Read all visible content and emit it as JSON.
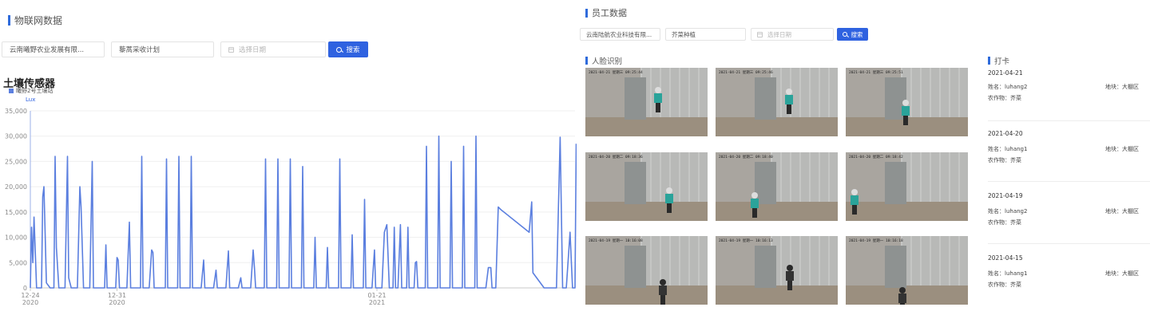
{
  "iot": {
    "title": "物联网数据",
    "company": "云南曦野农业发展有限...",
    "plan": "藜蒿采收计划",
    "date_placeholder": "选择日期",
    "search_label": "搜索"
  },
  "chart_data": {
    "type": "line",
    "title": "土壤传感器",
    "series": [
      {
        "name": "曦野2号土壤站",
        "color": "#5b7fdf"
      }
    ],
    "unit": "Lux",
    "ylim": [
      0,
      35000
    ],
    "yticks": [
      0,
      5000,
      10000,
      15000,
      20000,
      25000,
      30000,
      35000
    ],
    "ytick_labels": [
      "0",
      "5,000",
      "10,000",
      "15,000",
      "20,000",
      "25,000",
      "30,000",
      "35,000"
    ],
    "xticks": [
      {
        "label": "12-24",
        "sub": "2020",
        "x": 0
      },
      {
        "label": "12-31",
        "sub": "2020",
        "x": 7
      },
      {
        "label": "01-21",
        "sub": "2021",
        "x": 28
      }
    ],
    "xlim": [
      0,
      44
    ],
    "points": [
      [
        0,
        0
      ],
      [
        0.1,
        12000
      ],
      [
        0.2,
        5000
      ],
      [
        0.3,
        14000
      ],
      [
        0.5,
        0
      ],
      [
        0.9,
        0
      ],
      [
        1,
        18000
      ],
      [
        1.1,
        20000
      ],
      [
        1.3,
        1000
      ],
      [
        1.6,
        0
      ],
      [
        1.9,
        0
      ],
      [
        2,
        26000
      ],
      [
        2.1,
        8000
      ],
      [
        2.3,
        0
      ],
      [
        2.8,
        0
      ],
      [
        3,
        26000
      ],
      [
        3.1,
        2000
      ],
      [
        3.3,
        0
      ],
      [
        3.8,
        0
      ],
      [
        4,
        20000
      ],
      [
        4.1,
        16000
      ],
      [
        4.3,
        0
      ],
      [
        4.8,
        0
      ],
      [
        5,
        25000
      ],
      [
        5.1,
        0
      ],
      [
        6,
        0
      ],
      [
        6.1,
        8500
      ],
      [
        6.2,
        0
      ],
      [
        6.9,
        0
      ],
      [
        7,
        6000
      ],
      [
        7.1,
        5500
      ],
      [
        7.2,
        0
      ],
      [
        7.8,
        0
      ],
      [
        8,
        13000
      ],
      [
        8.1,
        0
      ],
      [
        8.9,
        0
      ],
      [
        9,
        26000
      ],
      [
        9.1,
        0
      ],
      [
        9.6,
        0
      ],
      [
        9.8,
        7500
      ],
      [
        9.9,
        7000
      ],
      [
        10,
        0
      ],
      [
        10.9,
        0
      ],
      [
        11,
        25500
      ],
      [
        11.1,
        0
      ],
      [
        11.9,
        0
      ],
      [
        12,
        26000
      ],
      [
        12.1,
        0
      ],
      [
        12.9,
        0
      ],
      [
        13,
        26000
      ],
      [
        13.1,
        0
      ],
      [
        13.8,
        0
      ],
      [
        14,
        5500
      ],
      [
        14.1,
        0
      ],
      [
        14.8,
        0
      ],
      [
        15,
        3500
      ],
      [
        15.1,
        0
      ],
      [
        15.8,
        0
      ],
      [
        16,
        7300
      ],
      [
        16.1,
        0
      ],
      [
        16.8,
        0
      ],
      [
        17,
        2000
      ],
      [
        17.1,
        0
      ],
      [
        17.8,
        0
      ],
      [
        18,
        7500
      ],
      [
        18.1,
        4000
      ],
      [
        18.2,
        0
      ],
      [
        18.9,
        0
      ],
      [
        19,
        25500
      ],
      [
        19.1,
        0
      ],
      [
        19.9,
        0
      ],
      [
        20,
        25500
      ],
      [
        20.1,
        0
      ],
      [
        20.9,
        0
      ],
      [
        21,
        25500
      ],
      [
        21.1,
        0
      ],
      [
        21.9,
        0
      ],
      [
        22,
        24000
      ],
      [
        22.1,
        0
      ],
      [
        22.9,
        0
      ],
      [
        23,
        10000
      ],
      [
        23.1,
        0
      ],
      [
        23.9,
        0
      ],
      [
        24,
        8000
      ],
      [
        24.1,
        0
      ],
      [
        24.9,
        0
      ],
      [
        25,
        25500
      ],
      [
        25.1,
        0
      ],
      [
        25.9,
        0
      ],
      [
        26,
        10500
      ],
      [
        26.1,
        0
      ],
      [
        26.9,
        0
      ],
      [
        27,
        17500
      ],
      [
        27.1,
        0
      ],
      [
        27.6,
        0
      ],
      [
        27.8,
        7500
      ],
      [
        27.9,
        0
      ],
      [
        28.4,
        0
      ],
      [
        28.6,
        11000
      ],
      [
        28.8,
        12500
      ],
      [
        29,
        0
      ],
      [
        29.3,
        0
      ],
      [
        29.4,
        12000
      ],
      [
        29.5,
        0
      ],
      [
        29.7,
        0
      ],
      [
        29.9,
        12500
      ],
      [
        30,
        0
      ],
      [
        30.4,
        0
      ],
      [
        30.5,
        12000
      ],
      [
        30.6,
        0
      ],
      [
        31,
        0
      ],
      [
        31.1,
        5000
      ],
      [
        31.2,
        5200
      ],
      [
        31.3,
        0
      ],
      [
        31.9,
        0
      ],
      [
        32,
        28000
      ],
      [
        32.1,
        0
      ],
      [
        32.9,
        0
      ],
      [
        33,
        30000
      ],
      [
        33.1,
        0
      ],
      [
        33.9,
        0
      ],
      [
        34,
        25000
      ],
      [
        34.1,
        0
      ],
      [
        34.9,
        0
      ],
      [
        35,
        28000
      ],
      [
        35.1,
        0
      ],
      [
        35.9,
        0
      ],
      [
        36,
        30000
      ],
      [
        36.1,
        0
      ],
      [
        36.8,
        0
      ],
      [
        37,
        4000
      ],
      [
        37.2,
        4000
      ],
      [
        37.3,
        0
      ],
      [
        37.6,
        0
      ],
      [
        37.8,
        16000
      ],
      [
        38,
        15500
      ],
      [
        40.3,
        11000
      ],
      [
        40.5,
        17000
      ],
      [
        40.6,
        3000
      ],
      [
        41.5,
        0
      ],
      [
        42.5,
        0
      ],
      [
        42.8,
        29800
      ],
      [
        43,
        0
      ],
      [
        43.3,
        0
      ],
      [
        43.6,
        11000
      ],
      [
        43.8,
        0
      ],
      [
        44,
        0
      ],
      [
        44.1,
        28500
      ]
    ]
  },
  "staff": {
    "title": "员工数据",
    "company": "云南陆航农业科技有限...",
    "plan": "芥菜种植",
    "date_placeholder": "选择日期",
    "search_label": "搜索"
  },
  "face": {
    "title": "人脸识别",
    "photos": [
      {
        "stamp": "2021-04-21 星期三 09:25:44"
      },
      {
        "stamp": "2021-04-21 星期三 09:25:46"
      },
      {
        "stamp": "2021-04-21 星期三 09:25:51"
      },
      {
        "stamp": "2021-04-20 星期二 09:18:36"
      },
      {
        "stamp": "2021-04-20 星期二 09:18:40"
      },
      {
        "stamp": "2021-04-20 星期二 09:18:42"
      },
      {
        "stamp": "2021-04-19 星期一 10:16:08"
      },
      {
        "stamp": "2021-04-19 星期一 10:16:13"
      },
      {
        "stamp": "2021-04-19 星期一 10:16:18"
      }
    ]
  },
  "checkin": {
    "title": "打卡",
    "name_prefix": "姓名：",
    "plot_prefix": "地块：",
    "crop_prefix": "农作物：",
    "records": [
      {
        "date": "2021-04-21",
        "name": "luhang2",
        "plot": "大棚区",
        "crop": "芥菜"
      },
      {
        "date": "2021-04-20",
        "name": "luhang1",
        "plot": "大棚区",
        "crop": "芥菜"
      },
      {
        "date": "2021-04-19",
        "name": "luhang2",
        "plot": "大棚区",
        "crop": "芥菜"
      },
      {
        "date": "2021-04-15",
        "name": "luhang1",
        "plot": "大棚区",
        "crop": "芥菜"
      }
    ]
  }
}
